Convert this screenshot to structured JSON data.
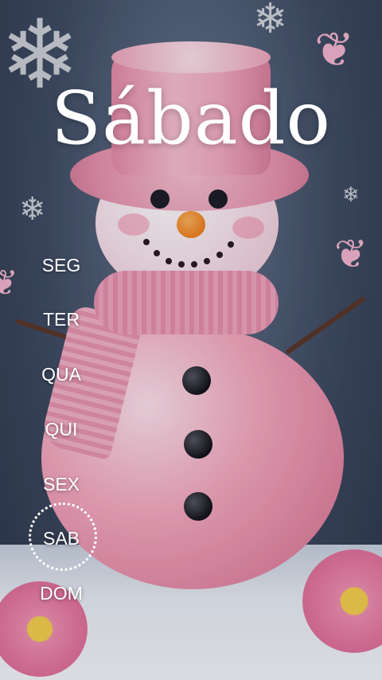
{
  "title": "Sábado",
  "days": [
    {
      "label": "SEG",
      "active": false
    },
    {
      "label": "TER",
      "active": false
    },
    {
      "label": "QUA",
      "active": false
    },
    {
      "label": "QUI",
      "active": false
    },
    {
      "label": "SEX",
      "active": false
    },
    {
      "label": "SAB",
      "active": true
    },
    {
      "label": "DOM",
      "active": false
    }
  ],
  "colors": {
    "text": "#ffffff",
    "accent_pink": "#f2a3ba",
    "background": "#3e4a60"
  },
  "background_image": "pink-snowman-winter-scene"
}
